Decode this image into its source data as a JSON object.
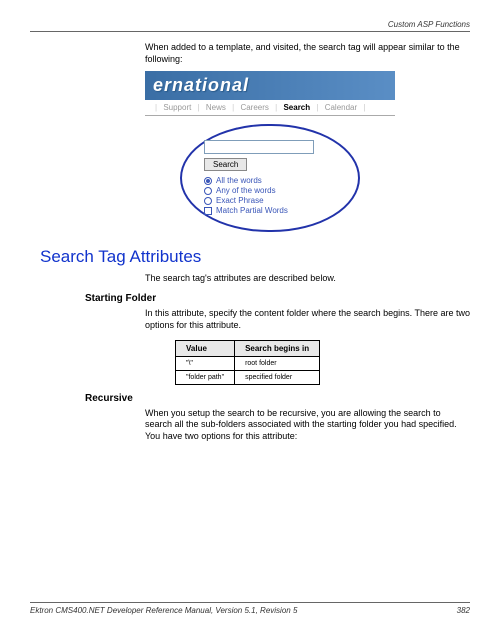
{
  "header": {
    "category": "Custom ASP Functions"
  },
  "intro": "When added to a template, and visited, the search tag will appear similar to the following:",
  "screenshot": {
    "banner_text": "ernational",
    "nav": {
      "items": [
        "Support",
        "News",
        "Careers",
        "Search",
        "Calendar"
      ],
      "active_index": 3
    },
    "search": {
      "button_label": "Search",
      "options": [
        "All the words",
        "Any of the words",
        "Exact Phrase"
      ],
      "checkbox_label": "Match Partial Words"
    }
  },
  "heading": "Search Tag Attributes",
  "heading_body": "The search tag's attributes are described below.",
  "sub1": {
    "title": "Starting Folder",
    "body": "In this attribute, specify the content folder where the search begins. There are two options for this attribute.",
    "table": {
      "headers": [
        "Value",
        "Search begins in"
      ],
      "rows": [
        [
          "\"\\\"",
          "root folder"
        ],
        [
          "\"folder path\"",
          "specified folder"
        ]
      ]
    }
  },
  "sub2": {
    "title": "Recursive",
    "body": "When you setup the search to be recursive, you are allowing the search to search all the sub-folders associated with the starting folder you had specified. You have two options for this attribute:"
  },
  "footer": {
    "left": "Ektron CMS400.NET Developer Reference Manual, Version 5.1, Revision 5",
    "right": "382"
  }
}
